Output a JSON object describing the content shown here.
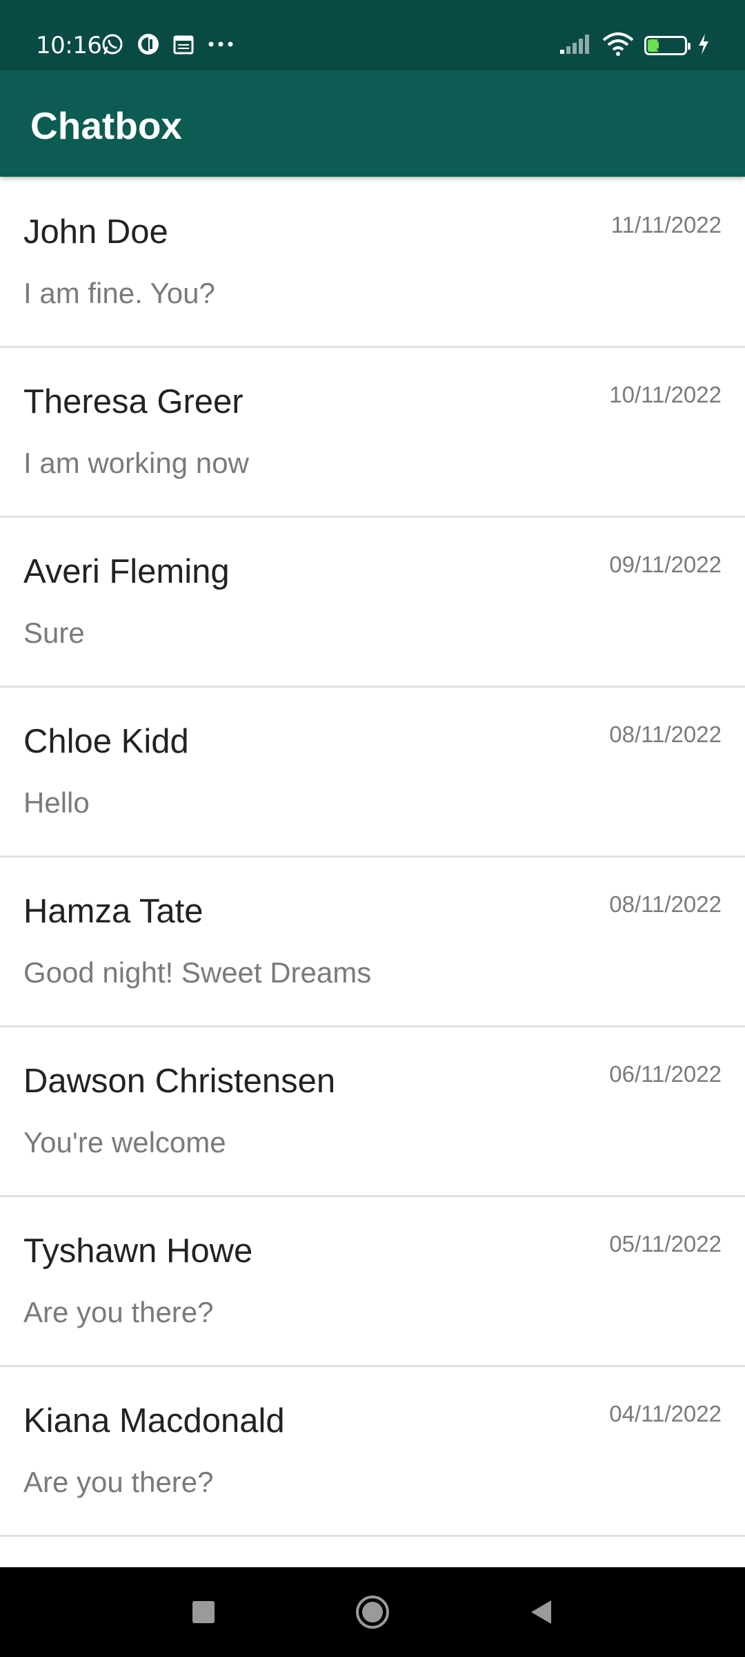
{
  "status_bar": {
    "time": "10:16",
    "battery_level": "30",
    "battery_fraction": 0.3,
    "icons": [
      "whatsapp-icon",
      "app-icon",
      "calendar-icon",
      "more-dots-icon",
      "signal-icon",
      "wifi-icon",
      "battery-icon",
      "charging-icon"
    ]
  },
  "app_bar": {
    "title": "Chatbox"
  },
  "colors": {
    "status_bar": "#0a4a44",
    "app_bar": "#0c5c53",
    "name_text": "#222222",
    "secondary_text": "#7a7a7a",
    "divider": "#e2e2e2"
  },
  "chats": [
    {
      "name": "John Doe",
      "preview": "I am fine. You?",
      "date": "11/11/2022"
    },
    {
      "name": "Theresa Greer",
      "preview": "I am working now",
      "date": "10/11/2022"
    },
    {
      "name": "Averi Fleming",
      "preview": "Sure",
      "date": "09/11/2022"
    },
    {
      "name": "Chloe Kidd",
      "preview": "Hello",
      "date": "08/11/2022"
    },
    {
      "name": "Hamza Tate",
      "preview": "Good night! Sweet Dreams",
      "date": "08/11/2022"
    },
    {
      "name": "Dawson Christensen",
      "preview": "You're welcome",
      "date": "06/11/2022"
    },
    {
      "name": "Tyshawn Howe",
      "preview": "Are you there?",
      "date": "05/11/2022"
    },
    {
      "name": "Kiana Macdonald",
      "preview": "Are you there?",
      "date": "04/11/2022"
    }
  ],
  "nav_bar": {
    "icons": [
      "recents-square-icon",
      "home-circle-icon",
      "back-triangle-icon"
    ]
  }
}
